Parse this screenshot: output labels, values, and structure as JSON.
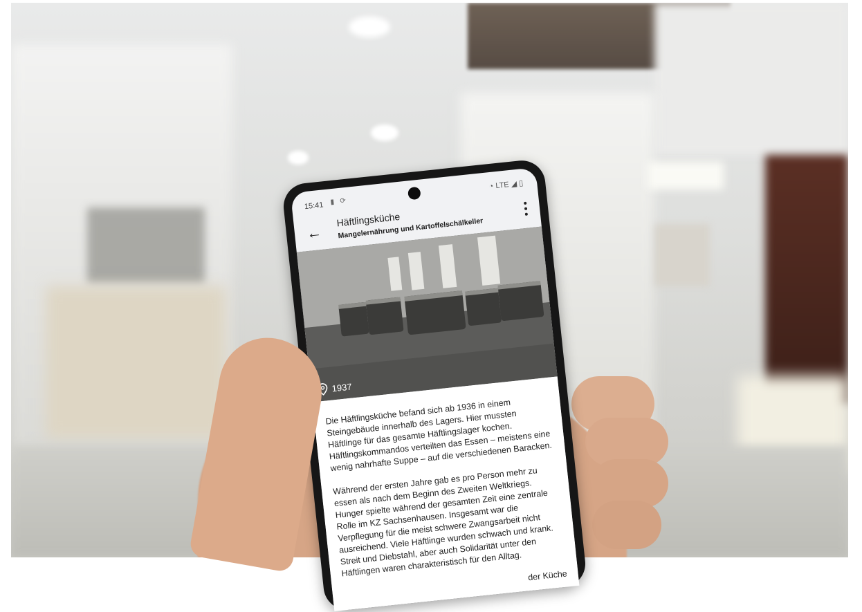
{
  "status": {
    "time": "15:41",
    "network": "LTE"
  },
  "appbar": {
    "title": "Häftlingsküche",
    "subtitle": "Mangelernährung und Kartoffelschälkeller"
  },
  "hero": {
    "year": "1937"
  },
  "article": {
    "paragraph_1": "Die Häftlingsküche befand sich ab 1936 in einem Steingebäude innerhalb des Lagers. Hier mussten Häftlinge für das gesamte Häftlingslager kochen. Häftlingskommandos verteilten das Essen – meistens eine wenig nahrhafte Suppe – auf die verschiedenen Baracken.",
    "paragraph_2": "Während der ersten Jahre gab es pro Person mehr zu essen als nach dem Beginn des Zweiten Weltkriegs. Hunger spielte während der gesamten Zeit eine zentrale Rolle im KZ Sachsenhausen. Insgesamt war die Verpflegung für die meist schwere Zwangsarbeit nicht ausreichend. Viele Häftlinge wurden schwach und krank. Streit und Diebstahl, aber auch Solidarität unter den Häftlingen waren charakteristisch für den Alltag.",
    "paragraph_3": "der Küche"
  },
  "icons": {
    "back": "arrow-left-icon",
    "menu": "more-vert-icon",
    "location": "location-pin-icon"
  },
  "colors": {
    "screen_bg": "#f1f2f4",
    "content_bg": "#ffffff",
    "phone_frame": "#161616"
  }
}
